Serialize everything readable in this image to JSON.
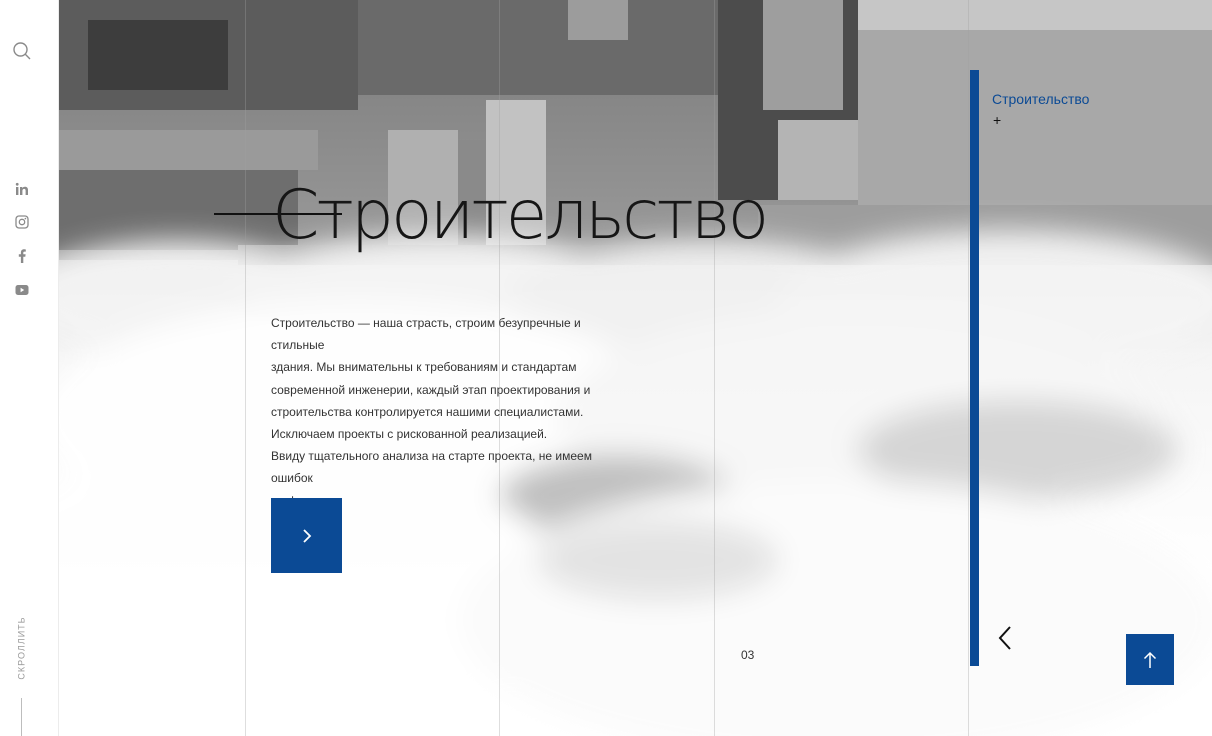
{
  "sidebar": {
    "search_icon": "search-icon",
    "social": [
      "linkedin-icon",
      "instagram-icon",
      "facebook-icon",
      "youtube-icon"
    ],
    "scroll_label": "СКРОЛЛИТЬ"
  },
  "hero": {
    "title": "Строительство",
    "description": [
      "Строительство — наша страсть, строим безупречные и стильные",
      "здания. Мы внимательны к требованиям и стандартам",
      "современной инженерии, каждый этап проектирования и",
      "строительства контролируется нашими специалистами.",
      "Исключаем проекты с рискованной реализацией.",
      "Ввиду тщательного анализа на старте проекта, не имеем ошибок",
      "на финише."
    ],
    "cta_icon": "chevron-right-icon"
  },
  "slider": {
    "slide_number": "03",
    "prev_icon": "chevron-left-icon"
  },
  "menu": {
    "active_label": "Строительство",
    "toggle": "+"
  },
  "scroll_top_icon": "arrow-up-icon",
  "colors": {
    "accent": "#0b4a95"
  }
}
